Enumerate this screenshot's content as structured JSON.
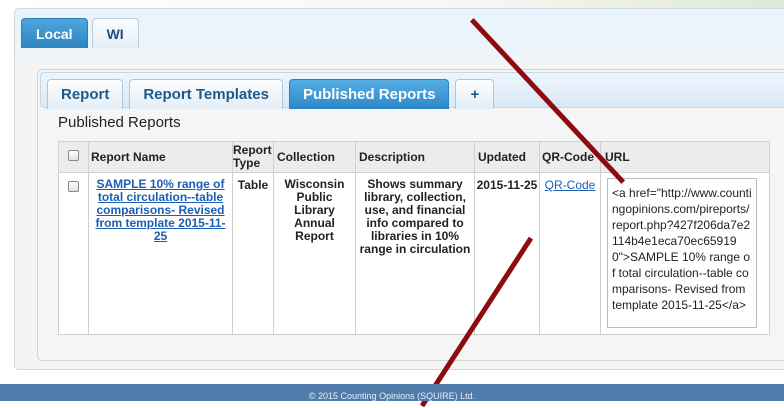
{
  "outer_tabs": [
    {
      "label": "Local",
      "active": true
    },
    {
      "label": "WI",
      "active": false
    }
  ],
  "inner_tabs": [
    {
      "label": "Report",
      "active": false
    },
    {
      "label": "Report Templates",
      "active": false
    },
    {
      "label": "Published Reports",
      "active": true
    },
    {
      "label": "+",
      "active": false
    }
  ],
  "section_title": "Published Reports",
  "table": {
    "headers": {
      "report_name": "Report Name",
      "report_type": "Report Type",
      "collection": "Collection",
      "description": "Description",
      "updated": "Updated",
      "qr_code": "QR-Code",
      "url": "URL"
    },
    "rows": [
      {
        "report_name": "SAMPLE 10% range of total circulation--table comparisons- Revised from template 2015-11-25",
        "report_type": "Table",
        "collection": "Wisconsin Public Library Annual Report",
        "description": "Shows summary library, collection, use, and financial info compared to libraries in 10% range in circulation",
        "updated": "2015-11-25",
        "qr_code": "QR-Code",
        "url": "<a href=\"http://www.countingopinions.com/pireports/report.php?427f206da7e2114b4e1eca70ec659190\">SAMPLE 10% range of total circulation--table comparisons- Revised from template 2015-11-25</a>"
      }
    ]
  },
  "footer": "© 2015 Counting Opinions (SQUIRE) Ltd.",
  "colors": {
    "accent": "#2d84c2",
    "slash": "#8d0a0f",
    "footer_bg": "#4f7cab"
  }
}
